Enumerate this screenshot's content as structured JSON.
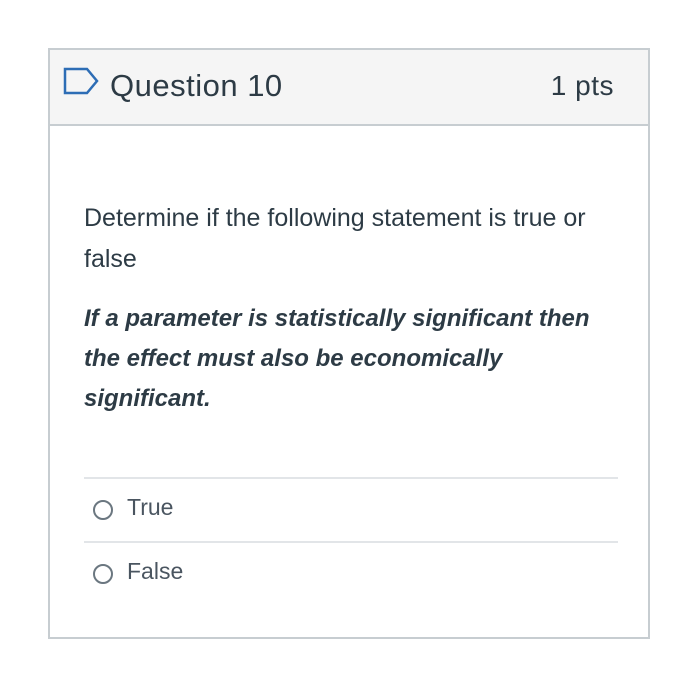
{
  "question": {
    "title": "Question 10",
    "points": "1 pts",
    "prompt": "Determine if the following statement is true or false",
    "statement": "If a parameter is statistically significant then the effect must also be economically significant.",
    "flag_icon": "bookmark-flag-icon"
  },
  "answers": [
    {
      "label": "True",
      "selected": false
    },
    {
      "label": "False",
      "selected": false
    }
  ],
  "colors": {
    "header_bg": "#f5f5f5",
    "border": "#c7cdd1",
    "text": "#2d3b45",
    "flag_outline": "#2d6db5"
  }
}
